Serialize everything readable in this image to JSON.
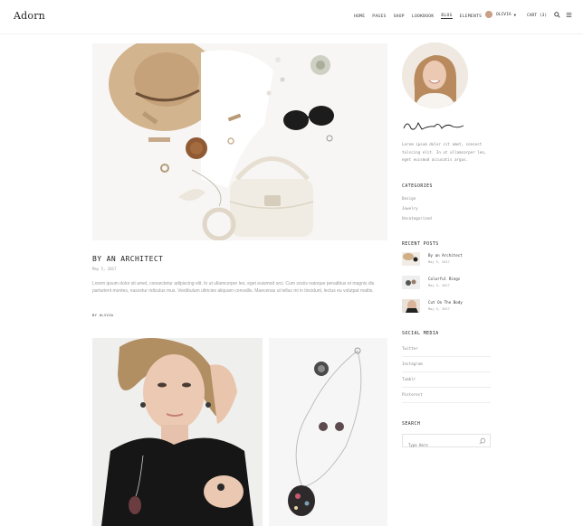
{
  "header": {
    "logo": "Adorn",
    "nav": [
      "HOME",
      "PAGES",
      "SHOP",
      "LOOKBOOK",
      "BLOG",
      "ELEMENTS"
    ],
    "active_nav": "BLOG",
    "user_name": "OLIVIA",
    "cart_label": "CART (3)"
  },
  "post": {
    "title": "BY AN ARCHITECT",
    "date": "May 5, 2017",
    "excerpt": "Lorem ipsum dolor sit amet, consectetur adipiscing elit. In ut ullamcorper leo, eget euismod orci. Cum sociis natoque penatibus et magnis dis parturient montes, nascetur ridiculus mus. Vestibulum ultricies aliquam convallis. Maecenas ut tellus mi in tincidunt, lectus eu volutpat mattis.",
    "author": "BY OLIVIA"
  },
  "sidebar": {
    "bio": "Lorem ipsum dolor sit amet, consect tulscing elit. In ut ullamcorper leo, eget euismod accusatis argus.",
    "categories_heading": "CATEGORIES",
    "categories": [
      "Design",
      "Jewelry",
      "Uncategorized"
    ],
    "recent_heading": "RECENT POSTS",
    "recent": [
      {
        "title": "By an Architect",
        "date": "May 5, 2017"
      },
      {
        "title": "Colorful Rings",
        "date": "May 5, 2017"
      },
      {
        "title": "Cut On The Body",
        "date": "May 5, 2017"
      }
    ],
    "social_heading": "SOCIAL MEDIA",
    "social": [
      "Twitter",
      "Instagram",
      "Tumblr",
      "Pinterest"
    ],
    "search_heading": "SEARCH",
    "search_placeholder": "Type Here"
  },
  "colors": {
    "text": "#222222",
    "muted": "#999999",
    "hat": "#c8a885",
    "background": "#ffffff"
  }
}
